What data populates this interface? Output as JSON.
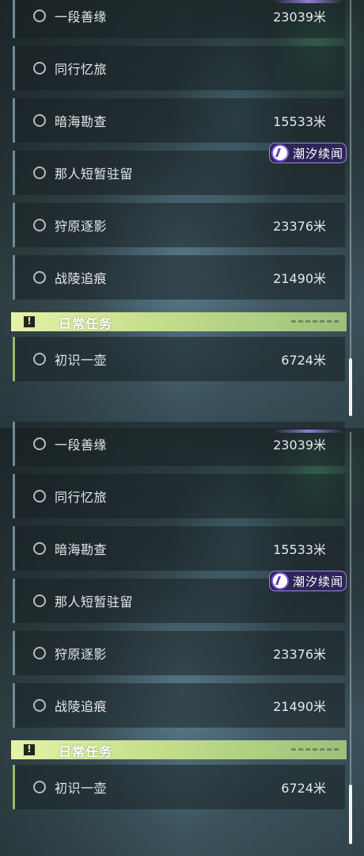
{
  "panels": [
    {
      "quests": [
        {
          "name": "一段善缘",
          "distance": "23039米"
        },
        {
          "name": "同行忆旅",
          "distance": ""
        },
        {
          "name": "暗海勘查",
          "distance": "15533米"
        },
        {
          "name": "那人短暂驻留",
          "distance": ""
        },
        {
          "name": "狩原逐影",
          "distance": "23376米"
        },
        {
          "name": "战陵追痕",
          "distance": "21490米"
        }
      ],
      "event_badge": "潮汐续闻",
      "daily_section_title": "日常任务",
      "daily_quests": [
        {
          "name": "初识一壶",
          "distance": "6724米"
        }
      ]
    },
    {
      "quests": [
        {
          "name": "一段善缘",
          "distance": "23039米"
        },
        {
          "name": "同行忆旅",
          "distance": ""
        },
        {
          "name": "暗海勘查",
          "distance": "15533米"
        },
        {
          "name": "那人短暂驻留",
          "distance": ""
        },
        {
          "name": "狩原逐影",
          "distance": "23376米"
        },
        {
          "name": "战陵追痕",
          "distance": "21490米"
        }
      ],
      "event_badge": "潮汐续闻",
      "daily_section_title": "日常任务",
      "daily_quests": [
        {
          "name": "初识一壶",
          "distance": "6724米"
        }
      ]
    }
  ],
  "icons": {
    "quest_status": "circle-outline-icon",
    "daily_header": "exclamation-box-icon",
    "event": "wave-logo-icon"
  },
  "colors": {
    "daily_header_gradient_start": "#e6f2a8",
    "daily_header_gradient_end": "#9cc07a",
    "event_badge_bg": "#2f2556",
    "event_badge_border": "#9f86e8",
    "quest_row_accent": "#6e8a99",
    "daily_row_accent": "#97b86a"
  }
}
